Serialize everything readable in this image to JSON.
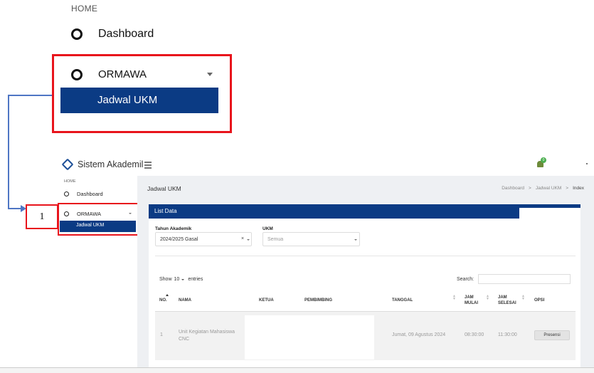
{
  "zoom": {
    "home": "HOME",
    "dashboard": "Dashboard",
    "ormawa": "ORMAWA",
    "active_item": "Jadwal UKM"
  },
  "step": {
    "number": "1"
  },
  "app": {
    "brand": "Sistem Akademil",
    "notification_count": "0"
  },
  "sidebar": {
    "home": "HOME",
    "items": [
      {
        "label": "Dashboard"
      },
      {
        "label": "ORMAWA"
      }
    ],
    "active_item": "Jadwal UKM"
  },
  "page": {
    "title": "Jadwal UKM",
    "breadcrumb": [
      "Dashboard",
      ">",
      "Jadwal UKM",
      ">",
      "Index"
    ]
  },
  "card": {
    "title": "List Data",
    "filters": {
      "tahun_label": "Tahun Akademik",
      "tahun_value": "2024/2025 Gasal",
      "ukm_label": "UKM",
      "ukm_placeholder": "Semua"
    },
    "table_controls": {
      "show": "Show",
      "length": "10",
      "entries": "entries",
      "search": "Search:"
    },
    "columns": [
      "NO.",
      "NAMA",
      "KETUA",
      "PEMBIMBING",
      "TANGGAL",
      "JAM MULAI",
      "JAM SELESAI",
      "OPSI"
    ],
    "rows": [
      {
        "no": "1",
        "nama": "Unit Kegiatan Mahasiswa CNC",
        "ketua": "",
        "pembimbing": "",
        "tanggal": "Jumat, 09 Agustus 2024",
        "jam_mulai": "08:30:00",
        "jam_selesai": "11:30:00",
        "opsi": "Presensi"
      }
    ]
  },
  "colors": {
    "primary": "#0b3b84",
    "highlight": "#e8141c",
    "connector": "#4f76c4"
  }
}
